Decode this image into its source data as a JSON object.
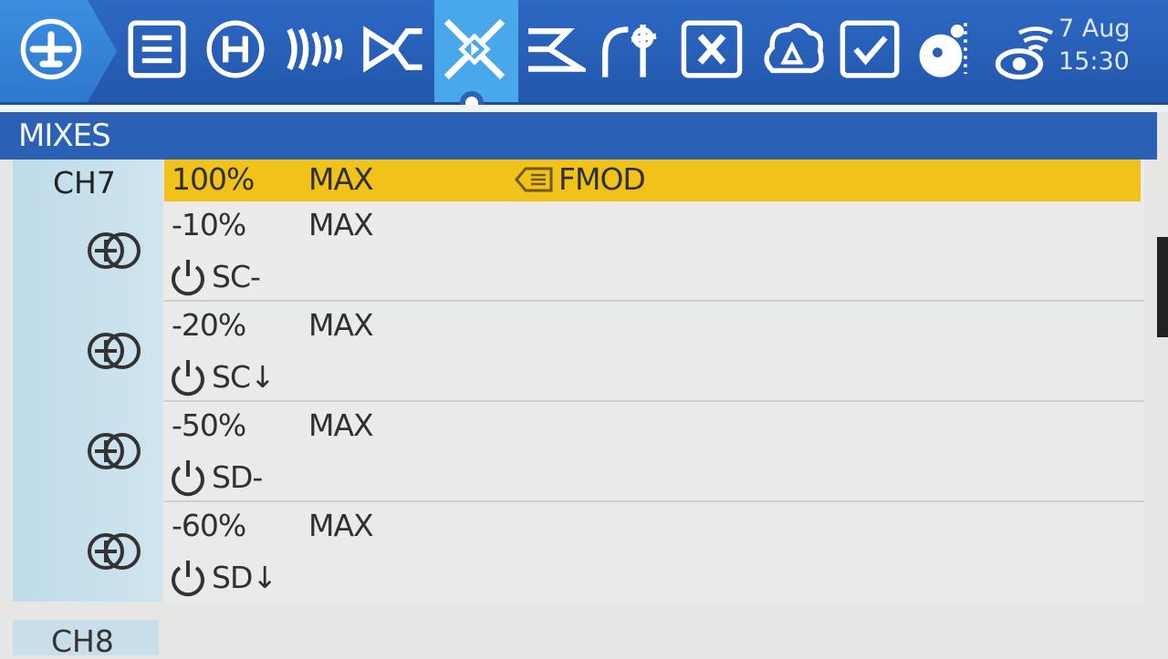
{
  "toolbar": {
    "icons": [
      "model-icon",
      "model-setup-icon",
      "heli-icon",
      "inputs-icon",
      "flight-modes-icon",
      "mixes-icon",
      "outputs-icon",
      "curves-icon",
      "logical-switches-icon",
      "special-functions-icon",
      "telemetry-icon",
      "checklist-icon",
      "trainer-icon",
      "radio-status-icon"
    ],
    "active_icon": "mixes-icon",
    "date": "7 Aug",
    "time": "15:30"
  },
  "page": {
    "title": "MIXES"
  },
  "channels": [
    {
      "label": "CH7",
      "mixes": [
        {
          "weight": "100%",
          "multiplex": "MAX",
          "flight_mode": "FMOD",
          "switch": "",
          "highlighted": true
        },
        {
          "weight": "-10%",
          "multiplex": "MAX",
          "switch": "SC-"
        },
        {
          "weight": "-20%",
          "multiplex": "MAX",
          "switch": "SC↓"
        },
        {
          "weight": "-50%",
          "multiplex": "MAX",
          "switch": "SD-"
        },
        {
          "weight": "-60%",
          "multiplex": "MAX",
          "switch": "SD↓"
        }
      ]
    },
    {
      "label": "CH8"
    }
  ],
  "colors": {
    "toolbar": "#2c68c4",
    "title_bar": "#2a61b5",
    "highlight": "#f0c21a",
    "channel_column": "#c7e0ec"
  }
}
